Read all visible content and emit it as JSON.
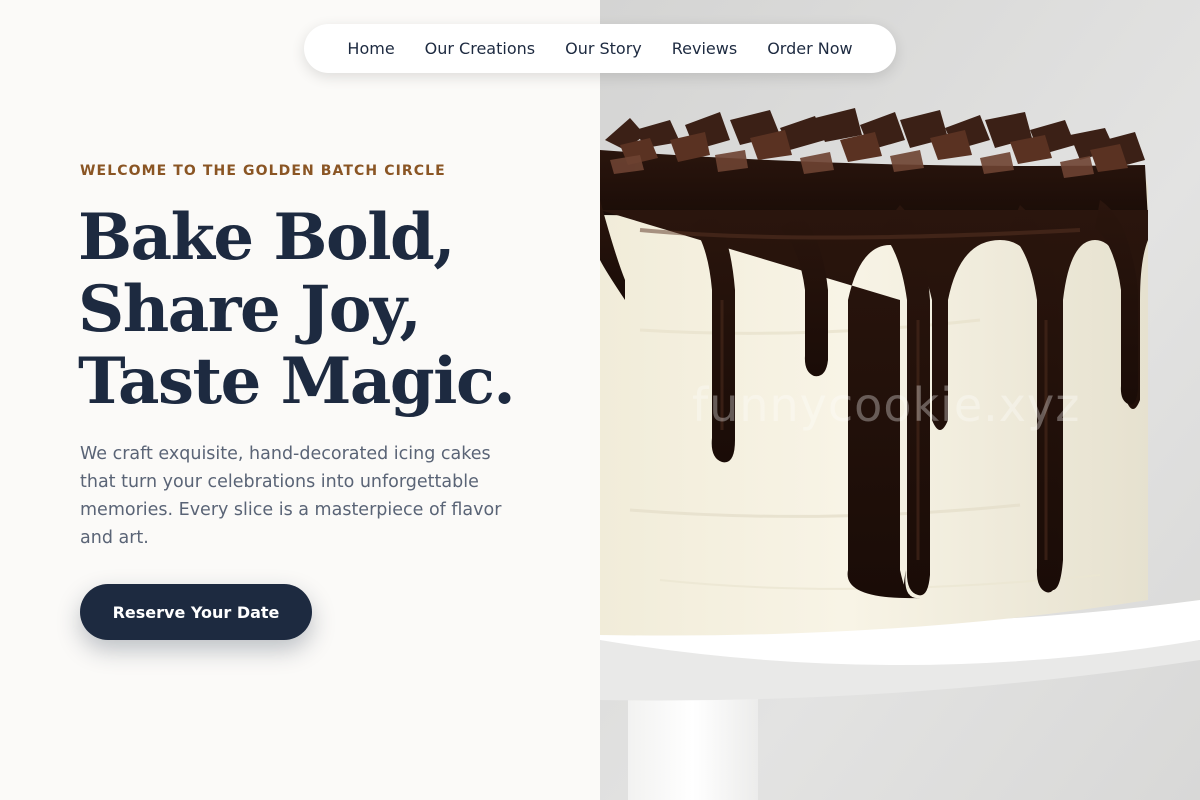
{
  "nav": {
    "items": [
      {
        "label": "Home"
      },
      {
        "label": "Our Creations"
      },
      {
        "label": "Our Story"
      },
      {
        "label": "Reviews"
      },
      {
        "label": "Order Now"
      }
    ]
  },
  "hero": {
    "eyebrow": "WELCOME TO THE GOLDEN BATCH CIRCLE",
    "headline_lines": [
      "Bake Bold,",
      "Share Joy,",
      "Taste Magic."
    ],
    "description": "We craft exquisite, hand-decorated icing cakes that turn your celebrations into unforgettable memories. Every slice is a masterpiece of flavor and art.",
    "cta_label": "Reserve Your Date"
  },
  "image": {
    "watermark": "funnycookie.xyz"
  },
  "colors": {
    "navy": "#1d2a40",
    "accent_brown": "#8a5524",
    "page_background": "#fbfaf8",
    "body_text": "#5a6476"
  }
}
